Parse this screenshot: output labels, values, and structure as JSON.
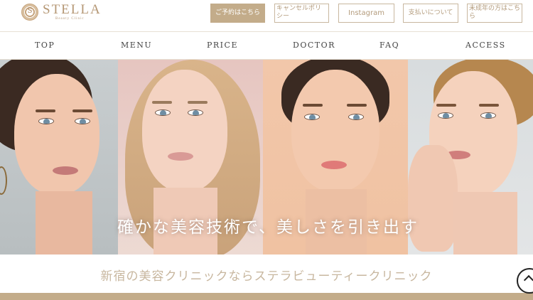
{
  "brand": {
    "name": "STELLA",
    "subtitle": "Beauty Clinic",
    "accent_color": "#c3ac8a"
  },
  "header_buttons": {
    "reserve": "ご予約はこちら",
    "cancel": "キャンセルポリシー",
    "instagram": "Instagram",
    "payment": "支払いについて",
    "minor": "未成年の方はこちら"
  },
  "nav": {
    "items": [
      {
        "label": "TOP"
      },
      {
        "label": "MENU"
      },
      {
        "label": "PRICE"
      },
      {
        "label": "DOCTOR"
      },
      {
        "label": "FAQ"
      },
      {
        "label": "ACCESS"
      }
    ]
  },
  "hero": {
    "caption": "確かな美容技術で、美しさを引き出す"
  },
  "tagline": "新宿の美容クリニックならステラビューティークリニック",
  "scroll_top": {
    "icon": "chevron-up-icon"
  }
}
